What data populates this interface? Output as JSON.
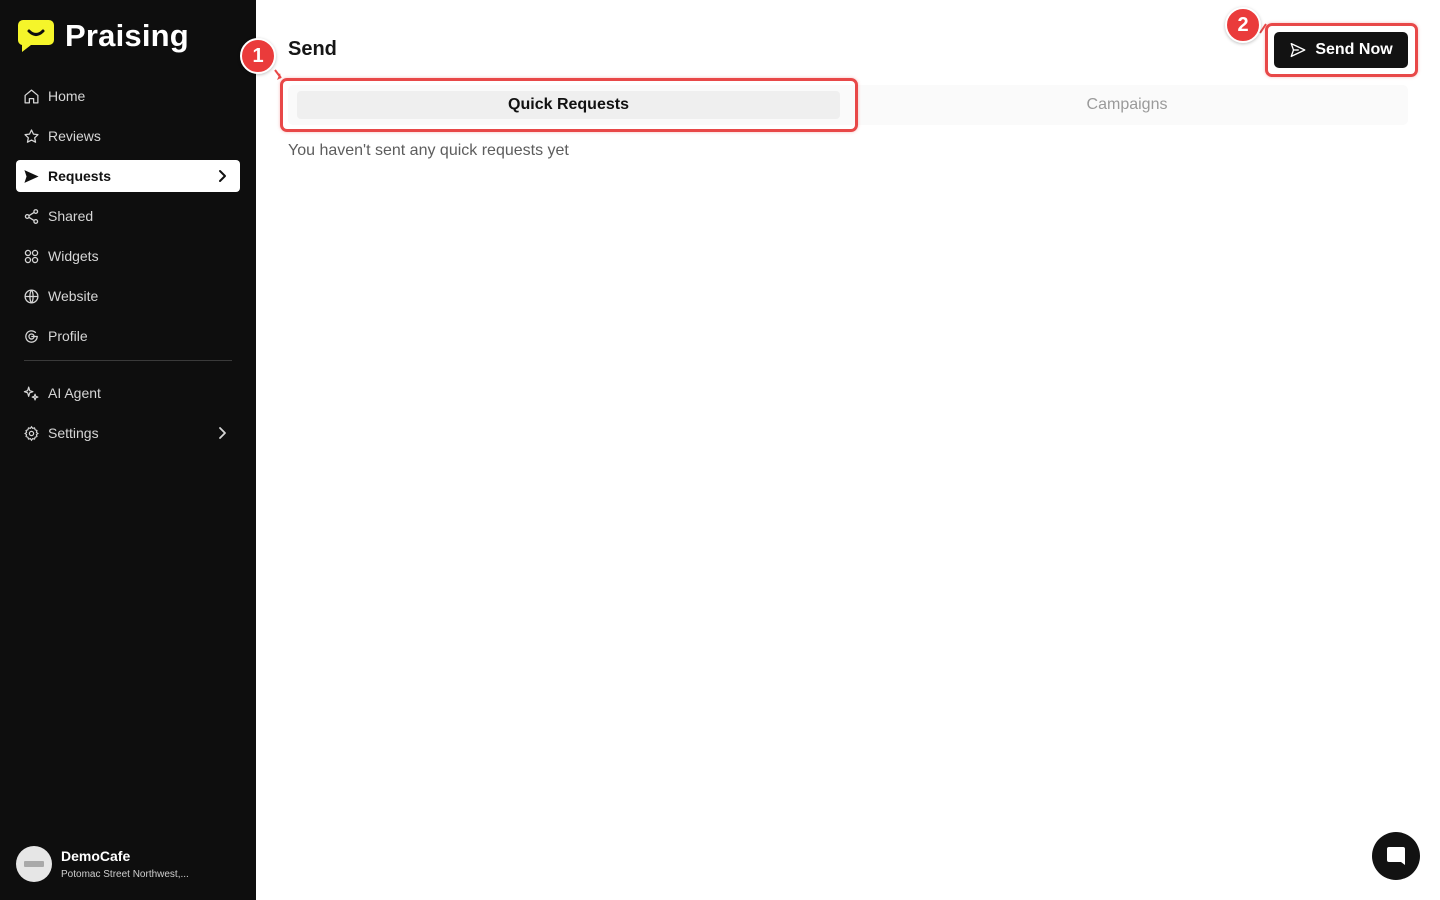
{
  "brand": {
    "name": "Praising",
    "accent": "#f5f52a"
  },
  "sidebar": {
    "items": [
      {
        "label": "Home",
        "icon": "home-icon"
      },
      {
        "label": "Reviews",
        "icon": "star-icon"
      },
      {
        "label": "Requests",
        "icon": "send-icon",
        "active": true
      },
      {
        "label": "Shared",
        "icon": "share-icon"
      },
      {
        "label": "Widgets",
        "icon": "widgets-icon"
      },
      {
        "label": "Website",
        "icon": "globe-icon"
      },
      {
        "label": "Profile",
        "icon": "google-icon"
      },
      {
        "label": "AI Agent",
        "icon": "sparkle-icon"
      },
      {
        "label": "Settings",
        "icon": "gear-icon"
      }
    ]
  },
  "account": {
    "name": "DemoCafe",
    "address": "Potomac Street Northwest,..."
  },
  "main": {
    "title": "Send",
    "send_button": "Send Now",
    "tabs": [
      {
        "label": "Quick Requests",
        "active": true
      },
      {
        "label": "Campaigns",
        "active": false
      }
    ],
    "empty_message": "You haven't sent any quick requests yet"
  },
  "annotations": {
    "step_1": "1",
    "step_2": "2",
    "color": "#e84848"
  }
}
